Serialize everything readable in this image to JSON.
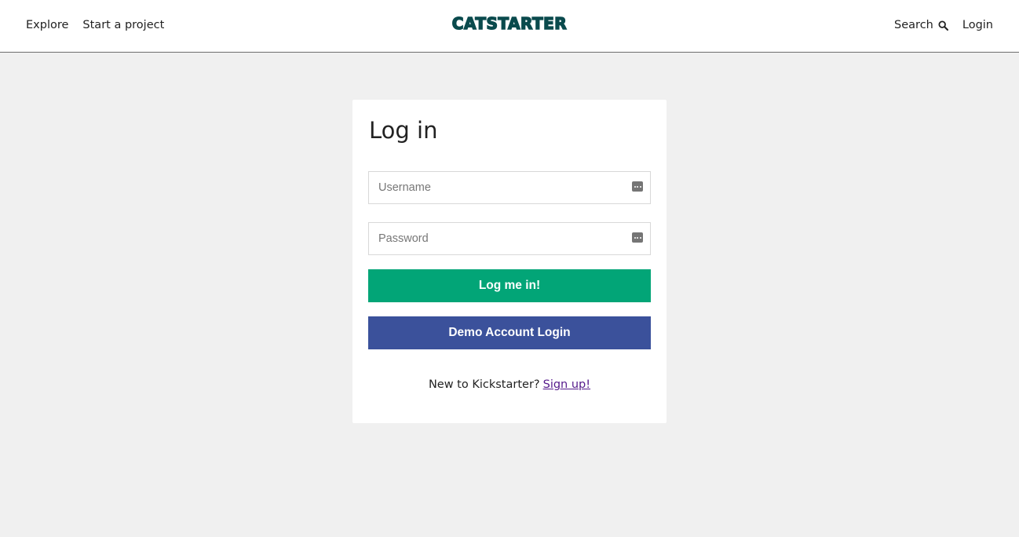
{
  "header": {
    "nav_left": [
      {
        "label": "Explore"
      },
      {
        "label": "Start a project"
      }
    ],
    "logo": "CATSTARTER",
    "search_label": "Search",
    "search_icon": "search-icon",
    "login_label": "Login"
  },
  "login_form": {
    "title": "Log in",
    "username_placeholder": "Username",
    "username_value": "",
    "username_icon": "autofill-icon",
    "password_placeholder": "Password",
    "password_value": "",
    "password_icon": "autofill-icon",
    "submit_label": "Log me in!",
    "demo_label": "Demo Account Login",
    "signup_prompt": "New to Kickstarter?",
    "signup_link": "Sign up!"
  },
  "colors": {
    "background": "#f0f0f0",
    "logo": "#0a4a4d",
    "login_button": "#02a577",
    "demo_button": "#3b519b",
    "signup_link": "#551a8b"
  }
}
